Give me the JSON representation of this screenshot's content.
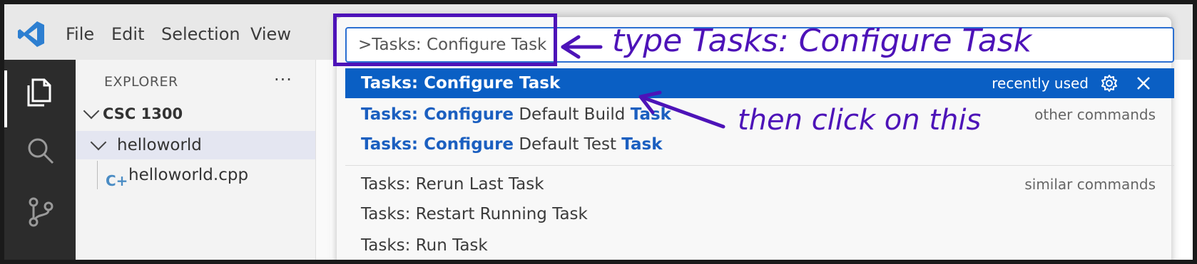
{
  "menu": {
    "items": [
      "File",
      "Edit",
      "Selection",
      "View"
    ]
  },
  "sidebar": {
    "title": "EXPLORER",
    "more_actions": "···",
    "folder": "CSC 1300",
    "subfolder": "helloworld",
    "file": "helloworld.cpp",
    "file_icon_glyph": "C+"
  },
  "command_palette": {
    "input_value": ">Tasks: Configure Task",
    "selected": {
      "label": "Tasks: Configure Task",
      "tag": "recently used"
    },
    "items": [
      {
        "prefix_hl": "Tasks: Configure",
        "middle": " Default Build ",
        "suffix_hl": "Task",
        "group": "other commands"
      },
      {
        "prefix_hl": "Tasks: Configure",
        "middle": " Default Test ",
        "suffix_hl": "Task",
        "group": ""
      },
      {
        "label": "Tasks: Rerun Last Task",
        "group": "similar commands"
      },
      {
        "label": "Tasks: Restart Running Task",
        "group": ""
      },
      {
        "label": "Tasks: Run Task",
        "group": ""
      }
    ]
  },
  "annotations": {
    "type_text": "type Tasks: Configure Task",
    "click_text": "then click on this",
    "color": "#4d13b8"
  },
  "colors": {
    "accent": "#0a5fc4",
    "highlight": "#1b5fc0",
    "vscode_blue": "#2d7fd1"
  }
}
